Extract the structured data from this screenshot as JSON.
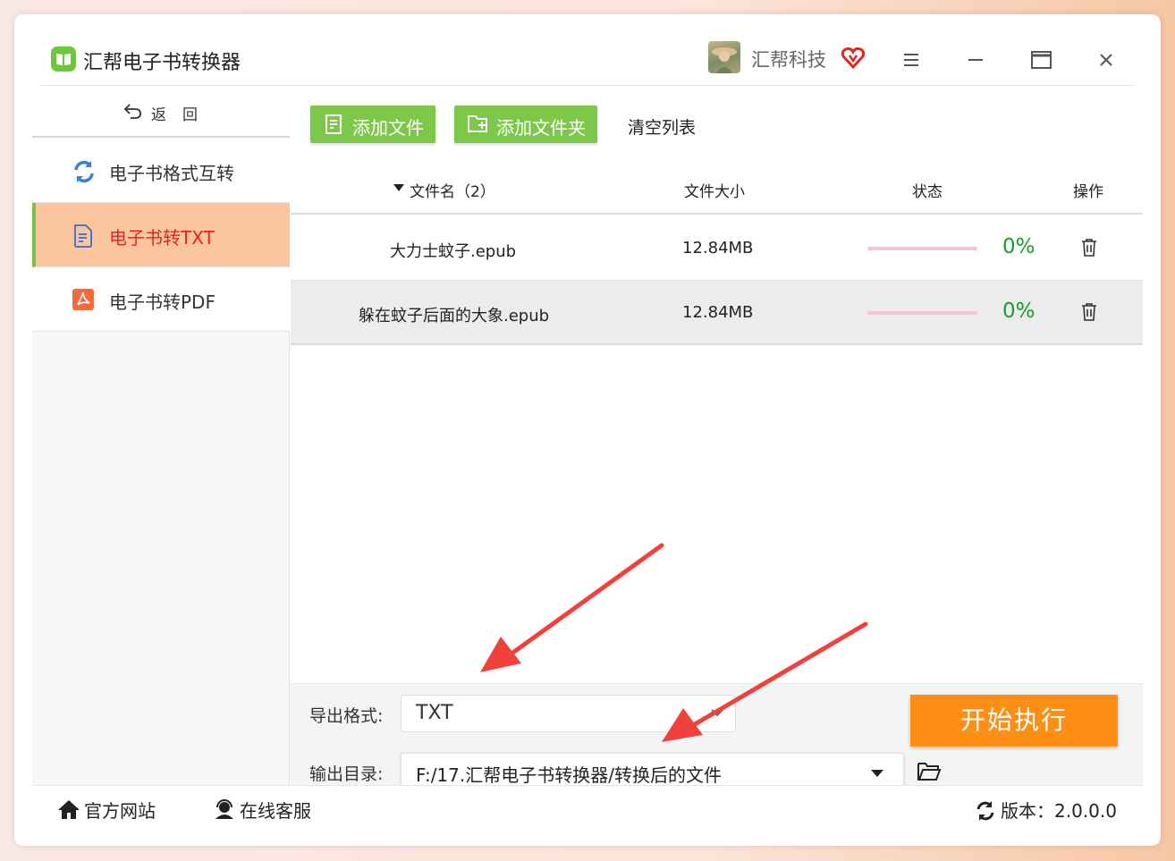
{
  "app": {
    "title": "汇帮电子书转换器",
    "company": "汇帮科技"
  },
  "colors": {
    "accent_green": "#7dc74b",
    "active_bg": "#fbc59d",
    "active_text": "#e8221d",
    "start_orange": "#fd8f15",
    "percent_green": "#1c9a2c",
    "annotation_red": "#f0413c"
  },
  "sidebar": {
    "back_label": "返回",
    "items": [
      {
        "label": "电子书格式互转",
        "icon": "refresh-icon",
        "active": false
      },
      {
        "label": "电子书转TXT",
        "icon": "document-icon",
        "active": true
      },
      {
        "label": "电子书转PDF",
        "icon": "pdf-icon",
        "active": false
      }
    ]
  },
  "toolbar": {
    "add_file": "添加文件",
    "add_folder": "添加文件夹",
    "clear_list": "清空列表"
  },
  "table": {
    "headers": {
      "name": "文件名（2）",
      "size": "文件大小",
      "status": "状态",
      "action": "操作"
    },
    "rows": [
      {
        "name": "大力士蚊子.epub",
        "size": "12.84MB",
        "progress": 0,
        "percent": "0%"
      },
      {
        "name": "躲在蚊子后面的大象.epub",
        "size": "12.84MB",
        "progress": 0,
        "percent": "0%"
      }
    ]
  },
  "output": {
    "format_label": "导出格式:",
    "format_value": "TXT",
    "dir_label": "输出目录:",
    "dir_value": "F:/17.汇帮电子书转换器/转换后的文件",
    "start_button": "开始执行"
  },
  "footer": {
    "website": "官方网站",
    "support": "在线客服",
    "version": "版本：2.0.0.0"
  }
}
